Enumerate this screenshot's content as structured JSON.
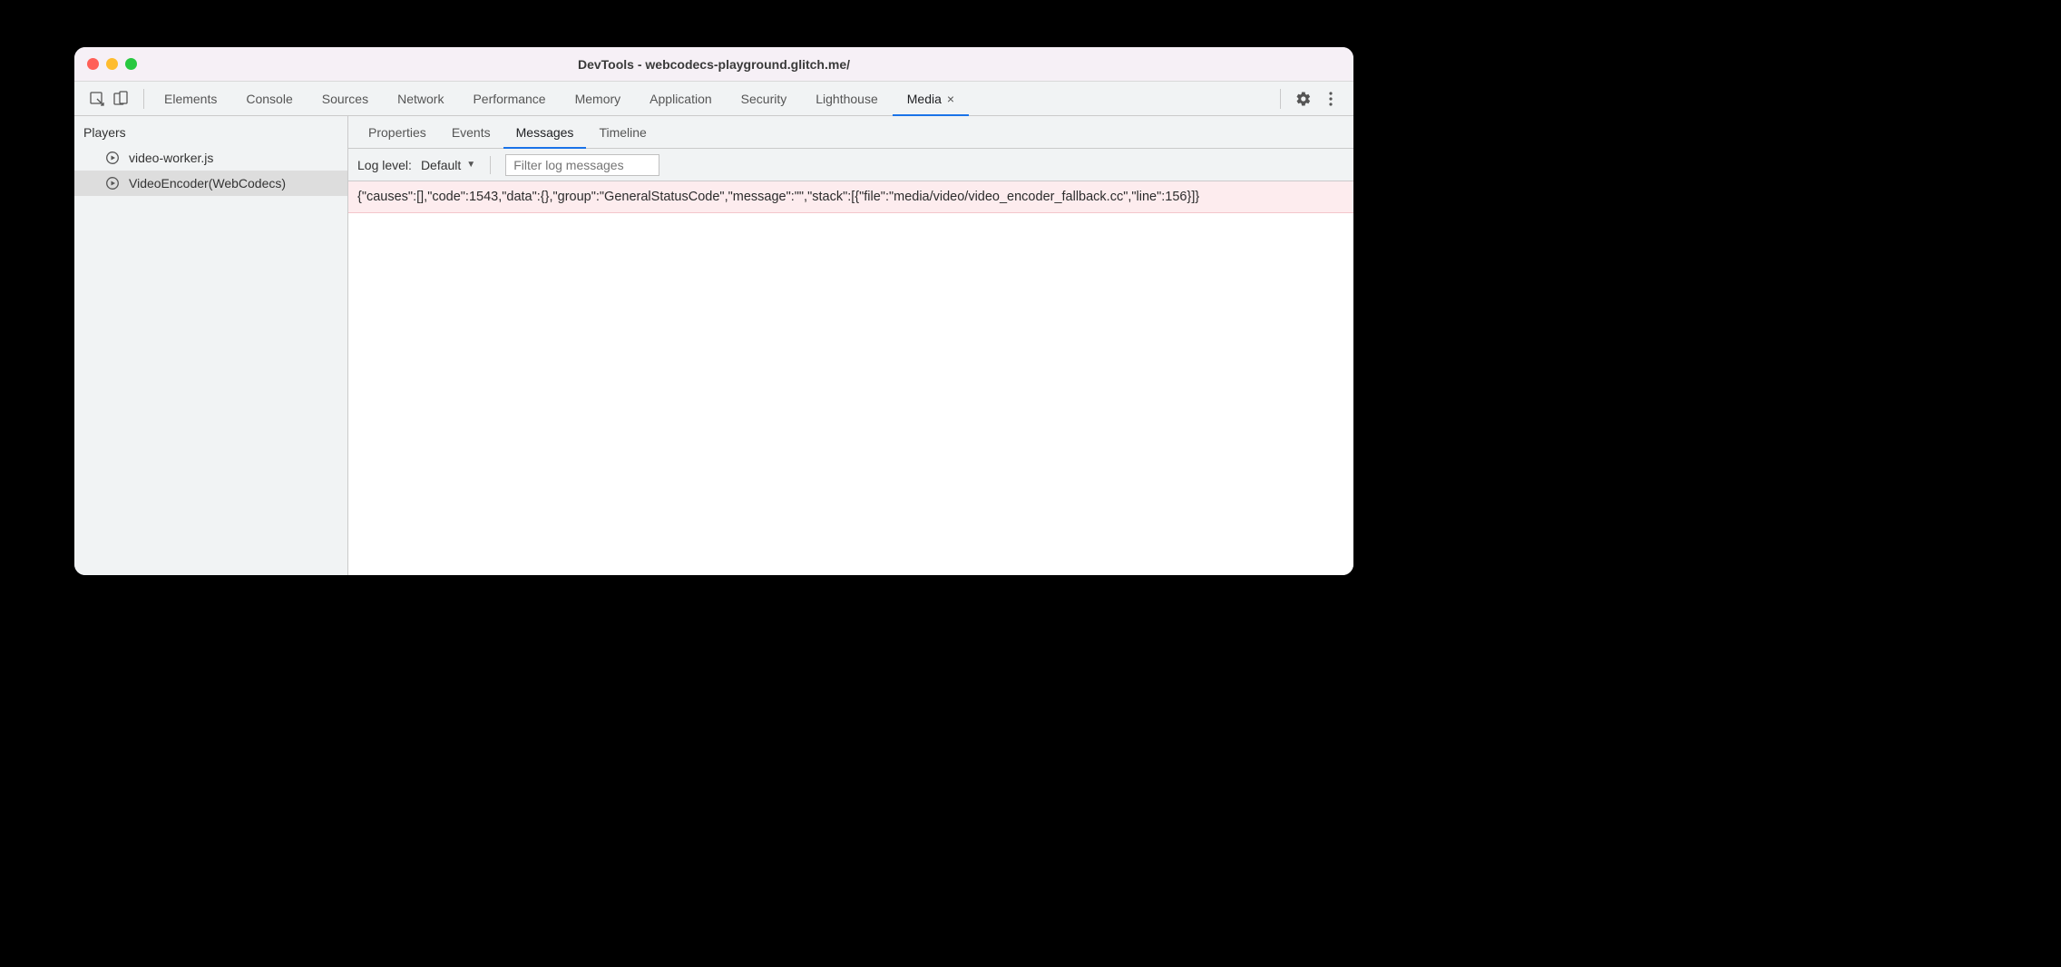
{
  "window": {
    "title": "DevTools - webcodecs-playground.glitch.me/"
  },
  "toolbar": {
    "tabs": [
      {
        "label": "Elements",
        "active": false
      },
      {
        "label": "Console",
        "active": false
      },
      {
        "label": "Sources",
        "active": false
      },
      {
        "label": "Network",
        "active": false
      },
      {
        "label": "Performance",
        "active": false
      },
      {
        "label": "Memory",
        "active": false
      },
      {
        "label": "Application",
        "active": false
      },
      {
        "label": "Security",
        "active": false
      },
      {
        "label": "Lighthouse",
        "active": false
      },
      {
        "label": "Media",
        "active": true,
        "closable": true
      }
    ]
  },
  "sidebar": {
    "heading": "Players",
    "items": [
      {
        "label": "video-worker.js",
        "selected": false
      },
      {
        "label": "VideoEncoder(WebCodecs)",
        "selected": true
      }
    ]
  },
  "subtabs": [
    {
      "label": "Properties",
      "active": false
    },
    {
      "label": "Events",
      "active": false
    },
    {
      "label": "Messages",
      "active": true
    },
    {
      "label": "Timeline",
      "active": false
    }
  ],
  "filterbar": {
    "loglevel_label": "Log level:",
    "loglevel_value": "Default",
    "filter_placeholder": "Filter log messages"
  },
  "messages": [
    {
      "text": "{\"causes\":[],\"code\":1543,\"data\":{},\"group\":\"GeneralStatusCode\",\"message\":\"\",\"stack\":[{\"file\":\"media/video/video_encoder_fallback.cc\",\"line\":156}]}"
    }
  ]
}
